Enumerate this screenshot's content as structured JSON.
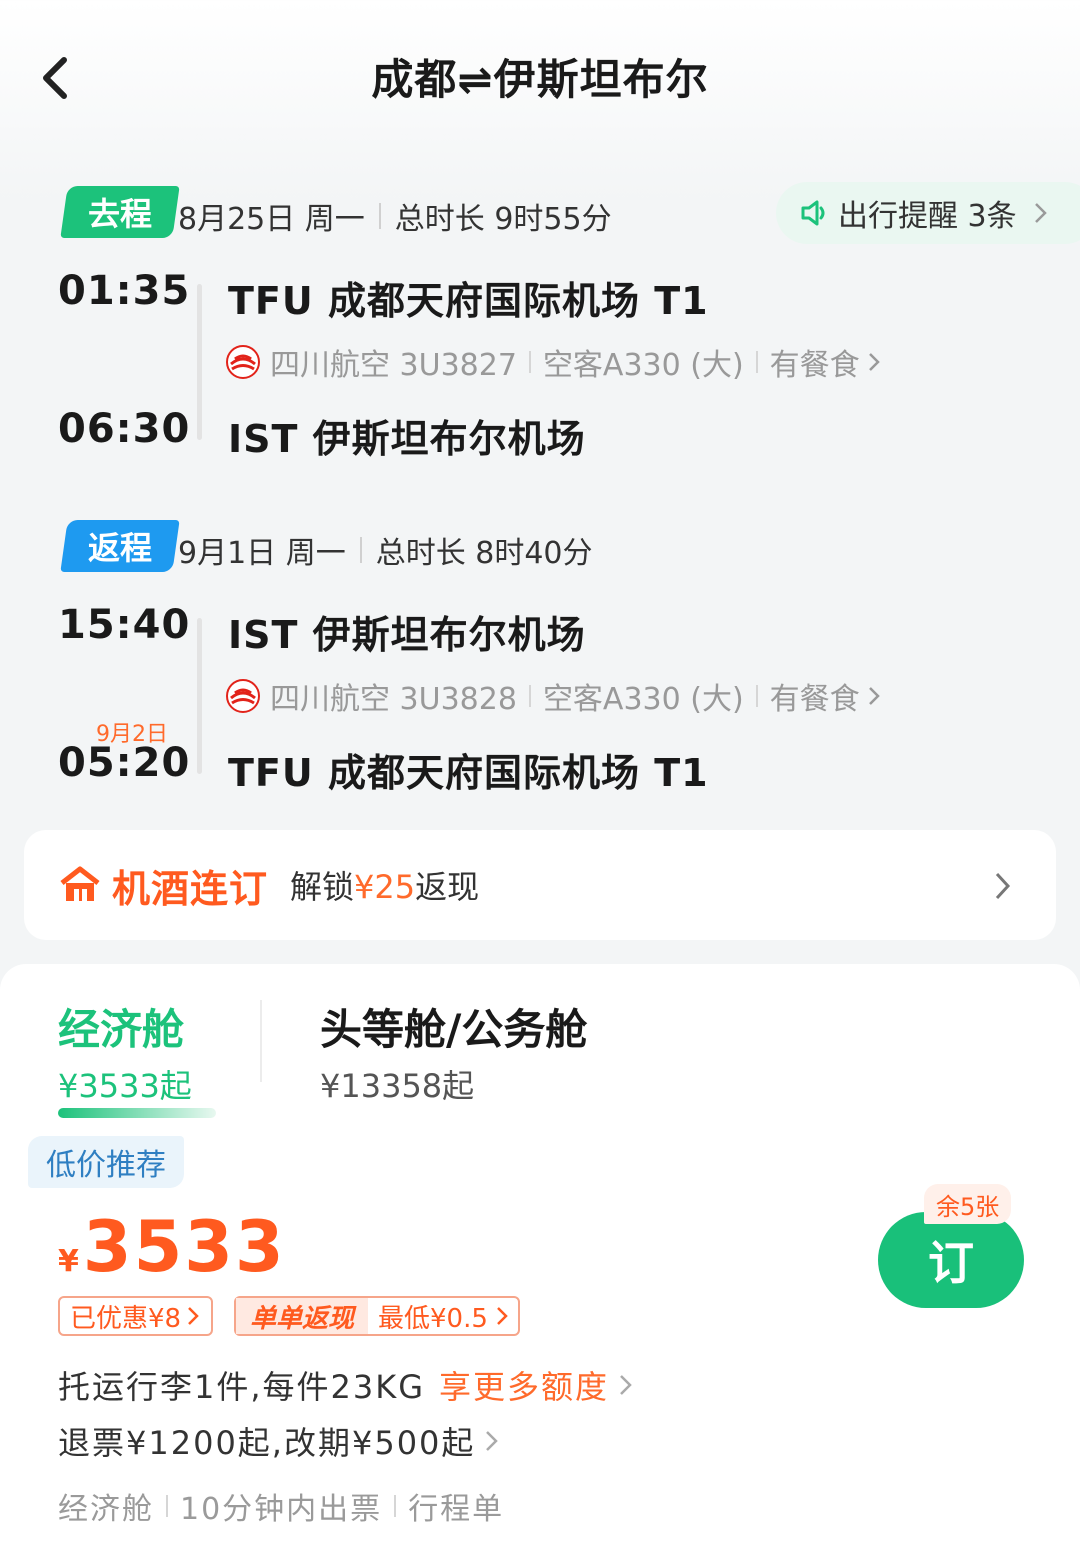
{
  "header": {
    "title": "成都⇌伊斯坦布尔"
  },
  "outbound": {
    "badge": "去程",
    "date": "8月25日 周一",
    "duration": "总时长 9时55分",
    "dep_time": "01:35",
    "dep_airport": "TFU 成都天府国际机场 T1",
    "airline_flight": "四川航空 3U3827",
    "aircraft": "空客A330 (大)",
    "meal": "有餐食",
    "arr_time": "06:30",
    "arr_airport": "IST 伊斯坦布尔机场"
  },
  "reminder": {
    "label": "出行提醒 3条"
  },
  "return": {
    "badge": "返程",
    "date": "9月1日 周一",
    "duration": "总时长 8时40分",
    "dep_time": "15:40",
    "dep_airport": "IST 伊斯坦布尔机场",
    "airline_flight": "四川航空 3U3828",
    "aircraft": "空客A330 (大)",
    "meal": "有餐食",
    "arr_date_note": "9月2日",
    "arr_time": "05:20",
    "arr_airport": "TFU 成都天府国际机场 T1"
  },
  "bundle": {
    "title": "机酒连订",
    "desc_prefix": "解锁",
    "desc_amount": "¥25",
    "desc_suffix": "返现"
  },
  "cabins": {
    "economy": {
      "title": "经济舱",
      "price": "¥3533起"
    },
    "business": {
      "title": "头等舱/公务舱",
      "price": "¥13358起"
    }
  },
  "offer": {
    "tag": "低价推荐",
    "currency": "¥",
    "price": "3533",
    "discount": "已优惠¥8",
    "cashback_label": "单单返现",
    "cashback_min": "最低¥0.5",
    "baggage": "托运行李1件,每件23KG",
    "baggage_more": "享更多额度",
    "refund": "退票¥1200起,改期¥500起",
    "features": [
      "经济舱",
      "10分钟内出票",
      "行程单"
    ],
    "remaining": "余5张",
    "book": "订"
  },
  "colors": {
    "green": "#1cc27b",
    "blue": "#1e9af0",
    "orange": "#ff5a1f"
  }
}
